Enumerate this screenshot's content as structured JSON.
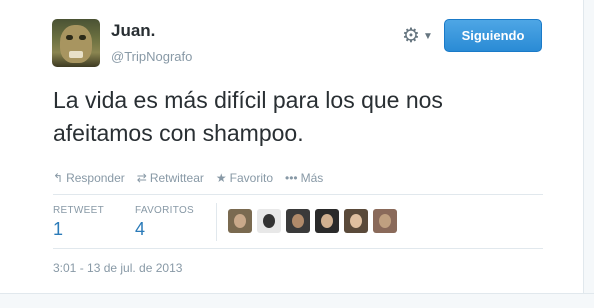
{
  "user": {
    "display_name": "Juan.",
    "username": "@TripNografo"
  },
  "header": {
    "gear_icon": "gear-icon",
    "follow_label": "Siguiendo",
    "accent_color": "#2b7bb9"
  },
  "tweet": {
    "text": "La vida es más difícil para los que nos afeitamos con shampoo.",
    "timestamp": "3:01 - 13 de jul. de 2013"
  },
  "actions": {
    "reply": "Responder",
    "retweet": "Retwittear",
    "favorite": "Favorito",
    "more": "Más"
  },
  "stats": {
    "retweet_label": "RETWEET",
    "retweet_count": "1",
    "favorites_label": "FAVORITOS",
    "favorites_count": "4"
  }
}
